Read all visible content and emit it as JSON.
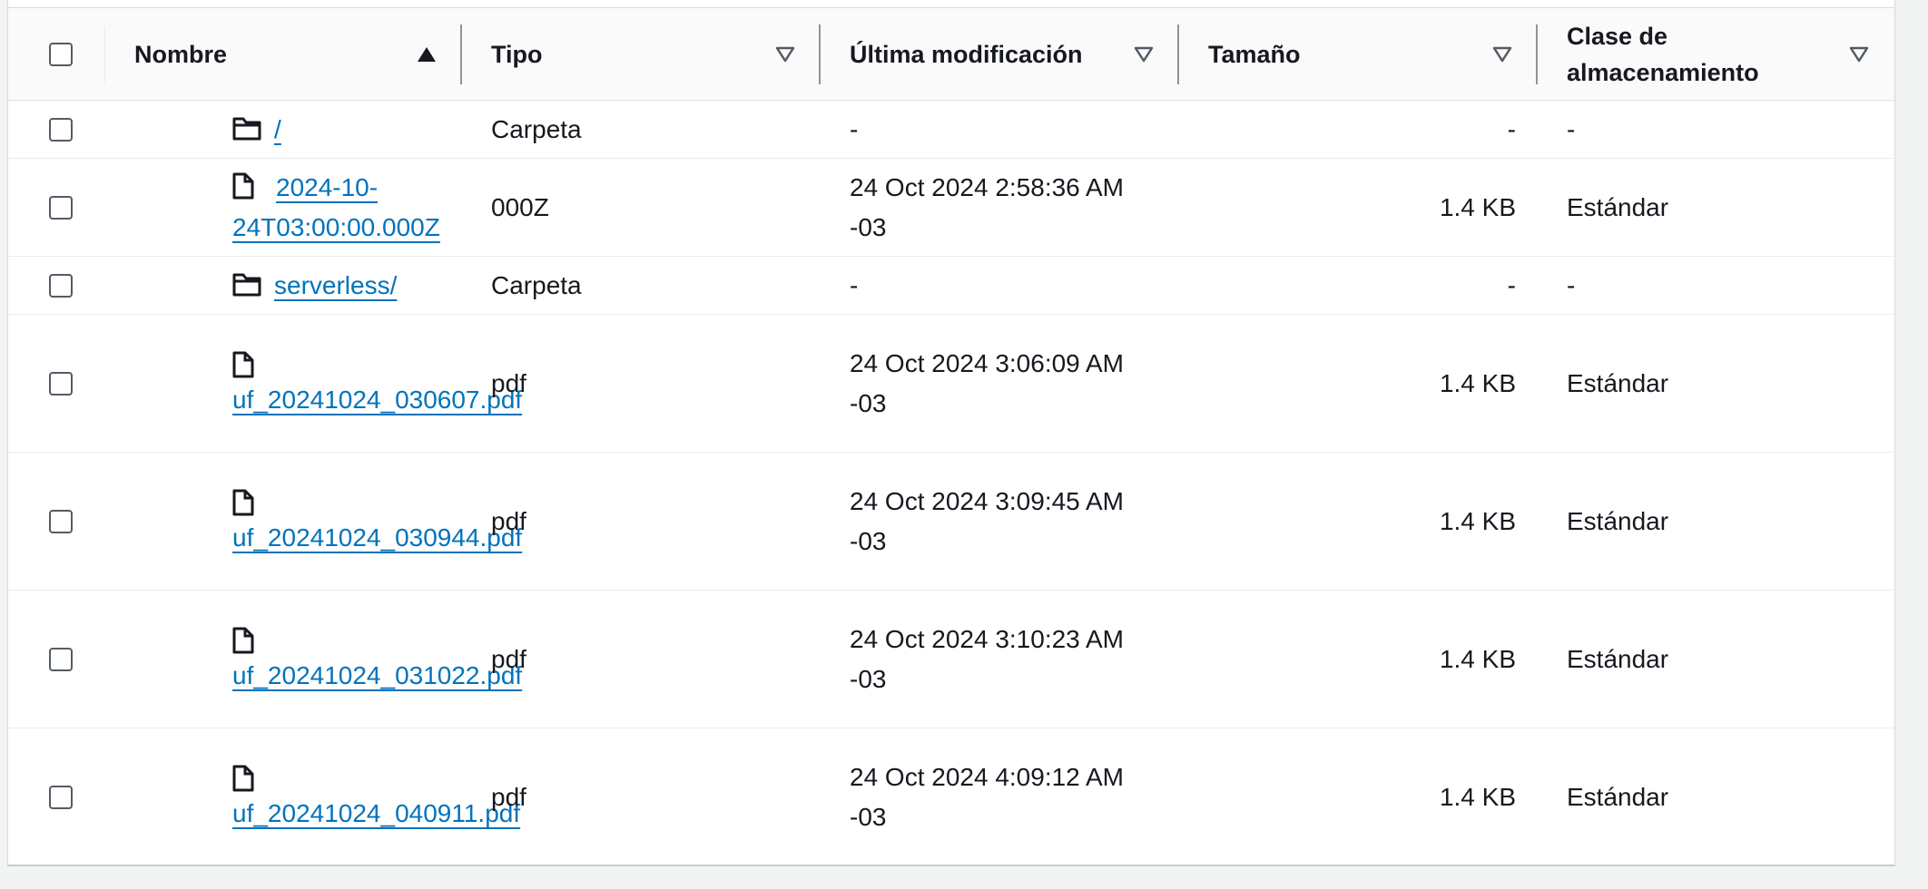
{
  "table": {
    "columns": [
      {
        "label": "Nombre",
        "sort": "ascending"
      },
      {
        "label": "Tipo",
        "sort": "none"
      },
      {
        "label": "Última modificación",
        "sort": "none"
      },
      {
        "label": "Tamaño",
        "sort": "none"
      },
      {
        "label": "Clase de almacenamiento",
        "sort": "none"
      }
    ],
    "rows": [
      {
        "icon": "folder-icon",
        "name": "/",
        "type": "Carpeta",
        "modified_line1": "-",
        "modified_line2": "",
        "size": "-",
        "storage_class": "-"
      },
      {
        "icon": "file-icon",
        "name": "2024-10-24T03:00:00.000Z",
        "type": "000Z",
        "modified_line1": "24 Oct 2024 2:58:36 AM",
        "modified_line2": "-03",
        "size": "1.4 KB",
        "storage_class": "Estándar"
      },
      {
        "icon": "folder-icon",
        "name": "serverless/",
        "type": "Carpeta",
        "modified_line1": "-",
        "modified_line2": "",
        "size": "-",
        "storage_class": "-"
      },
      {
        "icon": "file-icon",
        "name": "uf_20241024_030607.pdf",
        "type": "pdf",
        "modified_line1": "24 Oct 2024 3:06:09 AM",
        "modified_line2": "-03",
        "size": "1.4 KB",
        "storage_class": "Estándar"
      },
      {
        "icon": "file-icon",
        "name": "uf_20241024_030944.pdf",
        "type": "pdf",
        "modified_line1": "24 Oct 2024 3:09:45 AM",
        "modified_line2": "-03",
        "size": "1.4 KB",
        "storage_class": "Estándar"
      },
      {
        "icon": "file-icon",
        "name": "uf_20241024_031022.pdf",
        "type": "pdf",
        "modified_line1": "24 Oct 2024 3:10:23 AM",
        "modified_line2": "-03",
        "size": "1.4 KB",
        "storage_class": "Estándar"
      },
      {
        "icon": "file-icon",
        "name": "uf_20241024_040911.pdf",
        "type": "pdf",
        "modified_line1": "24 Oct 2024 4:09:12 AM",
        "modified_line2": "-03",
        "size": "1.4 KB",
        "storage_class": "Estándar"
      }
    ]
  },
  "colors": {
    "link": "#0073bb",
    "text": "#16191f",
    "header_bg": "#fafafa"
  }
}
